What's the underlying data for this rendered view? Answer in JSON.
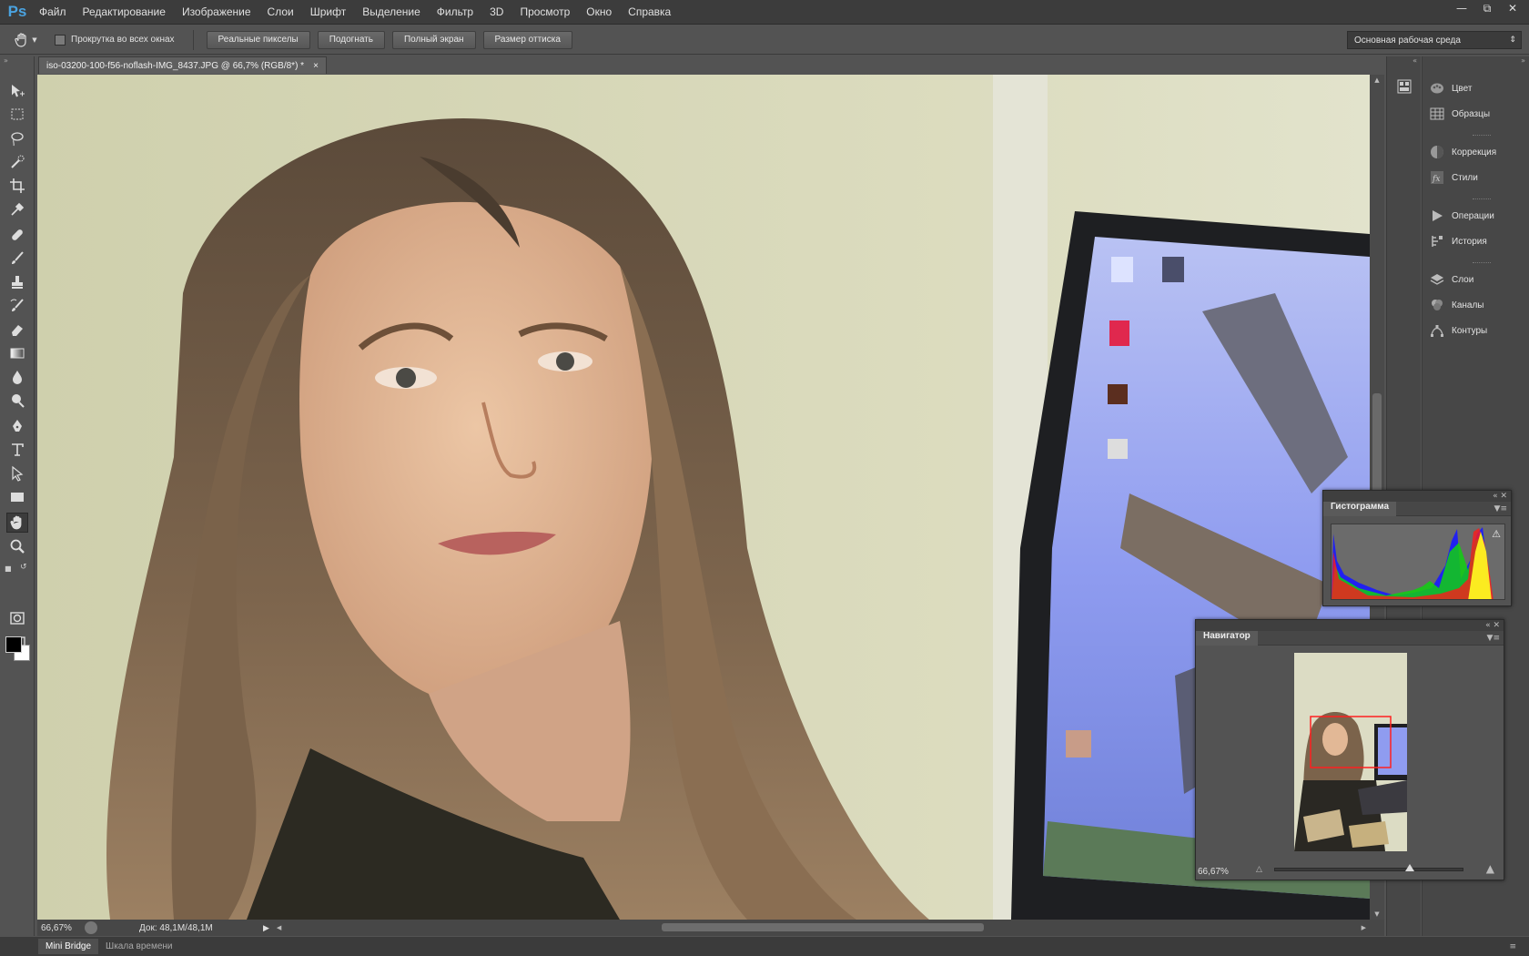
{
  "app": {
    "logo": "Ps",
    "accent": "#4aa3e0"
  },
  "menu": [
    "Файл",
    "Редактирование",
    "Изображение",
    "Слои",
    "Шрифт",
    "Выделение",
    "Фильтр",
    "3D",
    "Просмотр",
    "Окно",
    "Справка"
  ],
  "options": {
    "scroll_all_label": "Прокрутка во всех окнах",
    "buttons": [
      "Реальные пикселы",
      "Подогнать",
      "Полный экран",
      "Размер оттиска"
    ],
    "workspace": "Основная рабочая среда"
  },
  "document": {
    "tab_title": "iso-03200-100-f56-noflash-IMG_8437.JPG @ 66,7% (RGB/8*) *",
    "close": "×"
  },
  "status": {
    "zoom": "66,67%",
    "doc_info": "Док: 48,1M/48,1M"
  },
  "bottom_tabs": [
    "Mini Bridge",
    "Шкала времени"
  ],
  "right_panel": {
    "items": [
      "Цвет",
      "Образцы",
      "Коррекция",
      "Стили",
      "Операции",
      "История",
      "Слои",
      "Каналы",
      "Контуры"
    ]
  },
  "histogram": {
    "title": "Гистограмма"
  },
  "navigator": {
    "title": "Навигатор",
    "zoom": "66,67%",
    "zoom_fraction": 0.72
  }
}
